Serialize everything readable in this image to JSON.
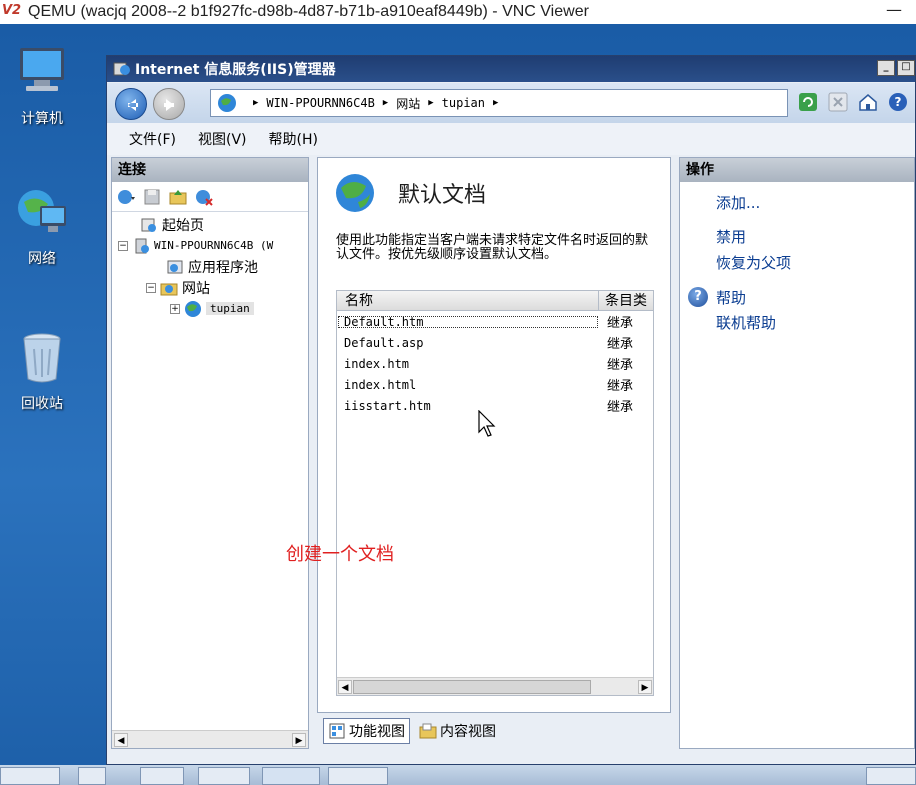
{
  "vnc": {
    "logo": "V2",
    "title": "QEMU (wacjq 2008--2 b1f927fc-d98b-4d87-b71b-a910eaf8449b) - VNC Viewer",
    "minimize": "—"
  },
  "desktop": {
    "icons": [
      {
        "label": "计算机",
        "icon": "computer-icon"
      },
      {
        "label": "网络",
        "icon": "network-icon"
      },
      {
        "label": "回收站",
        "icon": "recycle-bin-icon"
      }
    ]
  },
  "window": {
    "title": "Internet 信息服务(IIS)管理器",
    "address": {
      "crumbs": [
        "WIN-PPOURNN6C4B",
        "网站",
        "tupian"
      ]
    },
    "menu": [
      "文件(F)",
      "视图(V)",
      "帮助(H)"
    ],
    "left_pane": {
      "header": "连接",
      "tree": {
        "start_page": "起始页",
        "server": "WIN-PPOURNN6C4B (W",
        "app_pools": "应用程序池",
        "sites": "网站",
        "site": "tupian"
      }
    },
    "center": {
      "title": "默认文档",
      "description": "使用此功能指定当客户端未请求特定文件名时返回的默认文件。按优先级顺序设置默认文档。",
      "columns": [
        "名称",
        "条目类"
      ],
      "rows": [
        {
          "name": "Default.htm",
          "type": "继承"
        },
        {
          "name": "Default.asp",
          "type": "继承"
        },
        {
          "name": "index.htm",
          "type": "继承"
        },
        {
          "name": "index.html",
          "type": "继承"
        },
        {
          "name": "iisstart.htm",
          "type": "继承"
        }
      ]
    },
    "view_tabs": [
      "功能视图",
      "内容视图"
    ],
    "right_pane": {
      "header": "操作",
      "actions": [
        "添加...",
        "禁用",
        "恢复为父项"
      ],
      "help": "帮助",
      "online_help": "联机帮助"
    }
  },
  "annotation": "创建一个文档",
  "colors": {
    "annotation": "#e02020",
    "link": "#0b3d91",
    "title_bar": "#1f3d72"
  }
}
